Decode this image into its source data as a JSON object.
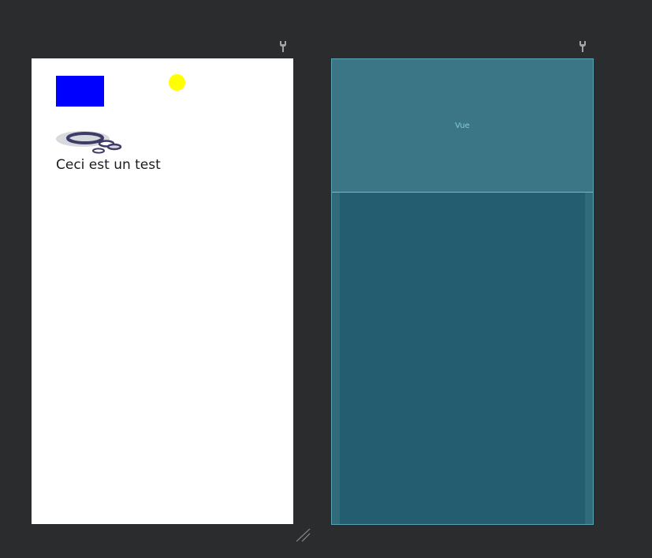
{
  "design_view": {
    "text_view": "Ceci est un test"
  },
  "blueprint_view": {
    "view_label": "Vue"
  },
  "icons": {
    "design_settings": "wrench-icon",
    "blueprint_settings": "wrench-icon",
    "resize": "resize-handle-icon"
  },
  "colors": {
    "canvas_background": "#2b2c2e",
    "blue_rectangle": "#0000ff",
    "yellow_circle": "#ffff00",
    "blueprint_background": "#235d6f",
    "blueprint_view_fill": "#3b7686",
    "blueprint_label": "#84c9d8"
  }
}
